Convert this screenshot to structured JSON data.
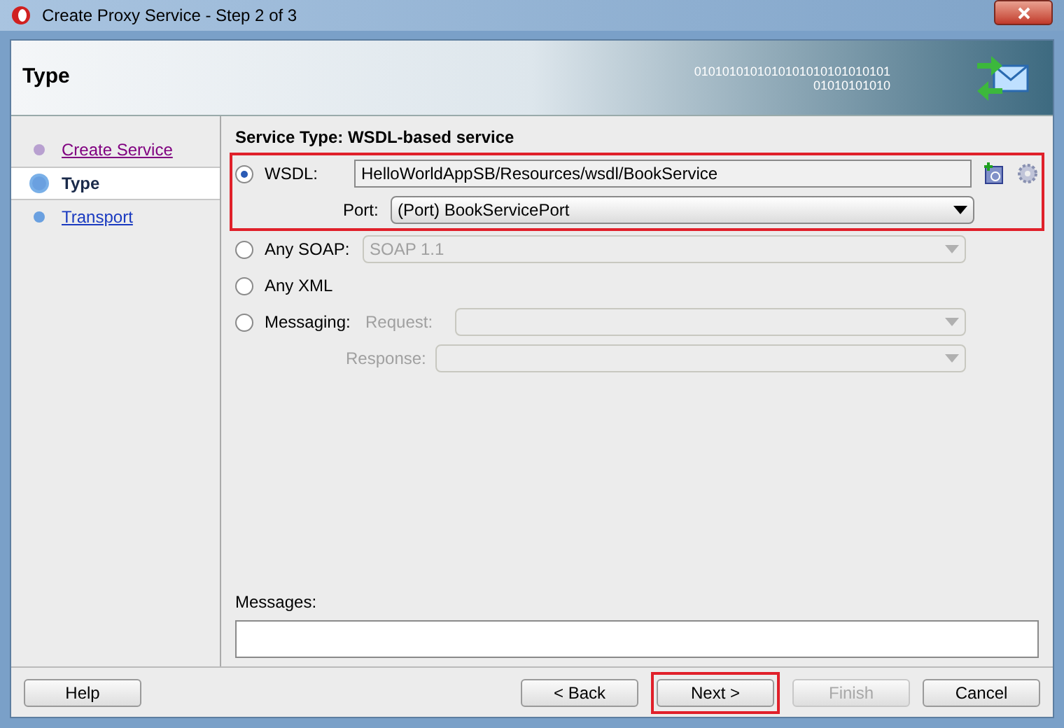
{
  "window": {
    "title": "Create Proxy Service - Step 2 of 3"
  },
  "header": {
    "title": "Type",
    "banner_digits": [
      "0101010101010101010101010101",
      "01010101010"
    ]
  },
  "steps": [
    {
      "label": "Create Service",
      "selected": false,
      "visited": true
    },
    {
      "label": "Type",
      "selected": true,
      "visited": false
    },
    {
      "label": "Transport",
      "selected": false,
      "visited": false
    }
  ],
  "service_type": "Service Type: WSDL-based service",
  "options": [
    {
      "label": "WSDL:",
      "selected": true,
      "value": "HelloWorldAppSB/Resources/wsdl/BookService",
      "port_label": "Port:",
      "port_value": "(Port) BookServicePort"
    },
    {
      "label": "Any SOAP:",
      "selected": false,
      "value": "SOAP 1.1"
    },
    {
      "label": "Any XML",
      "selected": false
    },
    {
      "label": "Messaging:",
      "selected": false,
      "request_label": "Request:",
      "response_label": "Response:"
    }
  ],
  "messages_label": "Messages:",
  "buttons": [
    {
      "label": "Help",
      "disabled": false,
      "highlighted": false
    },
    {
      "label": "< Back",
      "disabled": false,
      "highlighted": false
    },
    {
      "label": "Next >",
      "disabled": false,
      "highlighted": true
    },
    {
      "label": "Finish",
      "disabled": true,
      "highlighted": false
    },
    {
      "label": "Cancel",
      "disabled": false,
      "highlighted": false
    }
  ]
}
